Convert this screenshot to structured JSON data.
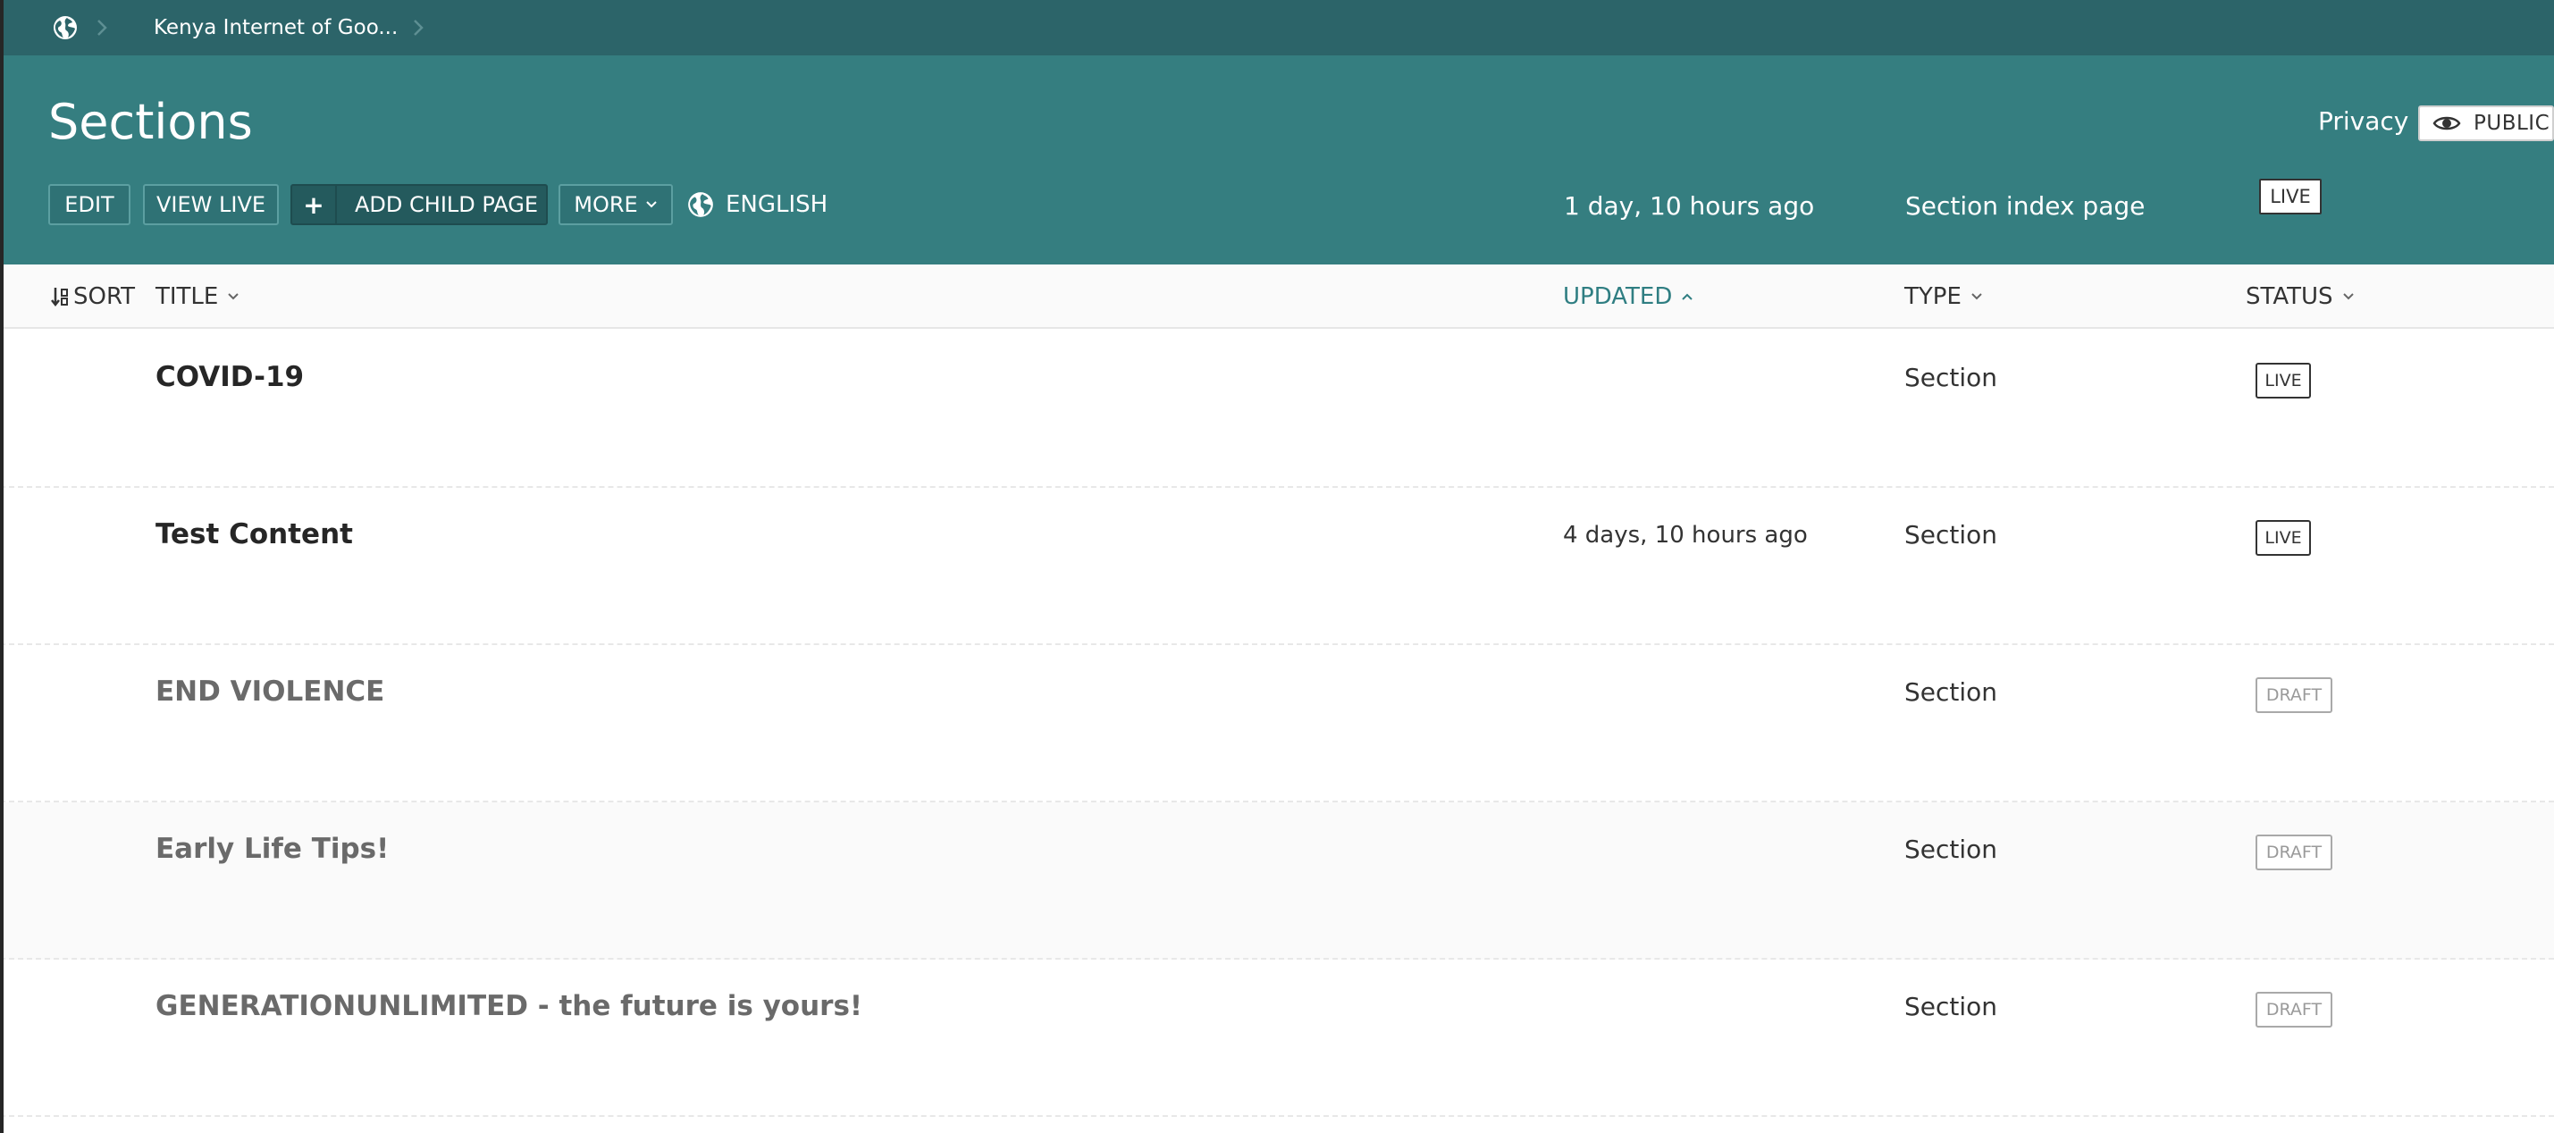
{
  "breadcrumb": {
    "home_icon": "globe-icon",
    "items": [
      {
        "label": "Kenya Internet of Goo..."
      }
    ]
  },
  "header": {
    "title": "Sections",
    "privacy_label": "Privacy",
    "public_label": "PUBLIC",
    "buttons": {
      "edit": "EDIT",
      "view_live": "VIEW LIVE",
      "add_child_plus": "+",
      "add_child": "ADD CHILD PAGE",
      "more": "MORE"
    },
    "language": "ENGLISH",
    "updated": "1 day, 10 hours ago",
    "type": "Section index page",
    "status": "LIVE"
  },
  "columns": {
    "sort": "SORT",
    "title": "TITLE",
    "updated": "UPDATED",
    "type": "TYPE",
    "status": "STATUS"
  },
  "rows": [
    {
      "title": "COVID-19",
      "updated": "",
      "type": "Section",
      "status": "LIVE"
    },
    {
      "title": "Test Content",
      "updated": "4 days, 10 hours ago",
      "type": "Section",
      "status": "LIVE"
    },
    {
      "title": "END VIOLENCE",
      "updated": "",
      "type": "Section",
      "status": "DRAFT"
    },
    {
      "title": "Early Life Tips!",
      "updated": "",
      "type": "Section",
      "status": "DRAFT"
    },
    {
      "title": "GENERATIONUNLIMITED - the future is yours!",
      "updated": "",
      "type": "Section",
      "status": "DRAFT"
    }
  ],
  "colors": {
    "breadcrumb_bg": "#2c6469",
    "header_bg": "#357e80",
    "accent_teal": "#2f7e82"
  }
}
